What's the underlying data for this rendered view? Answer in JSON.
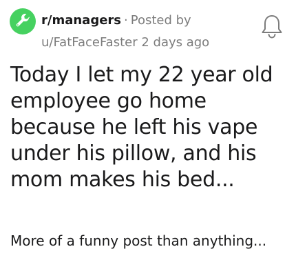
{
  "post": {
    "subreddit": "r/managers",
    "separator": "·",
    "posted_by_label": "Posted by",
    "author": "u/FatFaceFaster",
    "time_ago": "2 days ago",
    "title": "Today I let my 22 year old employee go home because he left his vape under his pillow, and his mom makes his bed...",
    "body": "More of a funny post than anything..."
  },
  "icons": {
    "subreddit_icon": "wrench-icon",
    "notification_icon": "bell-icon"
  },
  "colors": {
    "subreddit_icon_bg": "#46d160",
    "meta_text": "#7c7c7c",
    "primary_text": "#1a1a1b"
  }
}
